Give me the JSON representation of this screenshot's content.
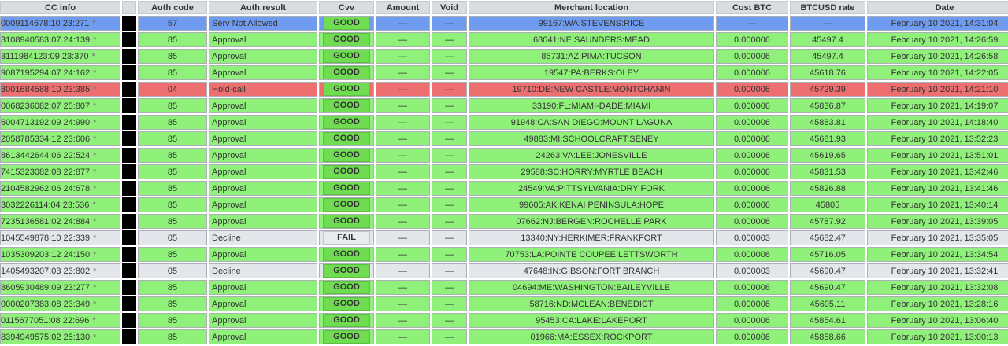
{
  "headers": [
    "CC info",
    "",
    "Auth code",
    "Auth result",
    "Cvv",
    "Amount",
    "Void",
    "Merchant location",
    "Cost BTC",
    "BTCUSD rate",
    "Date"
  ],
  "star": "*",
  "rows": [
    {
      "cc": "0009114678:10 23:271",
      "auth": "57",
      "result": "Serv Not Allowed",
      "cvv": "GOOD",
      "amount": "—",
      "void": "—",
      "location": "99167:WA:STEVENS:RICE",
      "cost": "—",
      "rate": "—",
      "date": "February 10 2021, 14:31:04",
      "status": "selected"
    },
    {
      "cc": "3108940583:07 24:139",
      "auth": "85",
      "result": "Approval",
      "cvv": "GOOD",
      "amount": "—",
      "void": "—",
      "location": "68041:NE:SAUNDERS:MEAD",
      "cost": "0.000006",
      "rate": "45497.4",
      "date": "February 10 2021, 14:26:59",
      "status": "approve"
    },
    {
      "cc": "3111984123:09 23:370",
      "auth": "85",
      "result": "Approval",
      "cvv": "GOOD",
      "amount": "—",
      "void": "—",
      "location": "85731:AZ:PIMA:TUCSON",
      "cost": "0.000006",
      "rate": "45497.4",
      "date": "February 10 2021, 14:26:58",
      "status": "approve"
    },
    {
      "cc": "9087195294:07 24:162",
      "auth": "85",
      "result": "Approval",
      "cvv": "GOOD",
      "amount": "—",
      "void": "—",
      "location": "19547:PA:BERKS:OLEY",
      "cost": "0.000006",
      "rate": "45618.76",
      "date": "February 10 2021, 14:22:05",
      "status": "approve"
    },
    {
      "cc": "8001684588:10 23:385",
      "auth": "04",
      "result": "Hold-call",
      "cvv": "GOOD",
      "amount": "—",
      "void": "—",
      "location": "19710:DE:NEW CASTLE:MONTCHANIN",
      "cost": "0.000006",
      "rate": "45729.39",
      "date": "February 10 2021, 14:21:10",
      "status": "hold"
    },
    {
      "cc": "0068236082:07 25:807",
      "auth": "85",
      "result": "Approval",
      "cvv": "GOOD",
      "amount": "—",
      "void": "—",
      "location": "33190:FL:MIAMI-DADE:MIAMI",
      "cost": "0.000006",
      "rate": "45836.87",
      "date": "February 10 2021, 14:19:07",
      "status": "approve"
    },
    {
      "cc": "6004713192:09 24:990",
      "auth": "85",
      "result": "Approval",
      "cvv": "GOOD",
      "amount": "—",
      "void": "—",
      "location": "91948:CA:SAN DIEGO:MOUNT LAGUNA",
      "cost": "0.000006",
      "rate": "45883.81",
      "date": "February 10 2021, 14:18:40",
      "status": "approve"
    },
    {
      "cc": "2058785334:12 23:606",
      "auth": "85",
      "result": "Approval",
      "cvv": "GOOD",
      "amount": "—",
      "void": "—",
      "location": "49883:MI:SCHOOLCRAFT:SENEY",
      "cost": "0.000006",
      "rate": "45681.93",
      "date": "February 10 2021, 13:52:23",
      "status": "approve"
    },
    {
      "cc": "8613442644:06 22:524",
      "auth": "85",
      "result": "Approval",
      "cvv": "GOOD",
      "amount": "—",
      "void": "—",
      "location": "24263:VA:LEE:JONESVILLE",
      "cost": "0.000006",
      "rate": "45619.65",
      "date": "February 10 2021, 13:51:01",
      "status": "approve"
    },
    {
      "cc": "7415323082:08 22:877",
      "auth": "85",
      "result": "Approval",
      "cvv": "GOOD",
      "amount": "—",
      "void": "—",
      "location": "29588:SC:HORRY:MYRTLE BEACH",
      "cost": "0.000006",
      "rate": "45831.53",
      "date": "February 10 2021, 13:42:46",
      "status": "approve"
    },
    {
      "cc": "2104582962:06 24:678",
      "auth": "85",
      "result": "Approval",
      "cvv": "GOOD",
      "amount": "—",
      "void": "—",
      "location": "24549:VA:PITTSYLVANIA:DRY FORK",
      "cost": "0.000006",
      "rate": "45826.88",
      "date": "February 10 2021, 13:41:46",
      "status": "approve"
    },
    {
      "cc": "3032226114:04 23:536",
      "auth": "85",
      "result": "Approval",
      "cvv": "GOOD",
      "amount": "—",
      "void": "—",
      "location": "99605:AK:KENAI PENINSULA:HOPE",
      "cost": "0.000006",
      "rate": "45805",
      "date": "February 10 2021, 13:40:14",
      "status": "approve"
    },
    {
      "cc": "7235136581:02 24:884",
      "auth": "85",
      "result": "Approval",
      "cvv": "GOOD",
      "amount": "—",
      "void": "—",
      "location": "07662:NJ:BERGEN:ROCHELLE PARK",
      "cost": "0.000006",
      "rate": "45787.92",
      "date": "February 10 2021, 13:39:05",
      "status": "approve"
    },
    {
      "cc": "1045549878:10 22:339",
      "auth": "05",
      "result": "Decline",
      "cvv": "FAIL",
      "amount": "—",
      "void": "—",
      "location": "13340:NY:HERKIMER:FRANKFORT",
      "cost": "0.000003",
      "rate": "45682.47",
      "date": "February 10 2021, 13:35:05",
      "status": "decline"
    },
    {
      "cc": "1035309203:12 24:150",
      "auth": "85",
      "result": "Approval",
      "cvv": "GOOD",
      "amount": "—",
      "void": "—",
      "location": "70753:LA:POINTE COUPEE:LETTSWORTH",
      "cost": "0.000006",
      "rate": "45716.05",
      "date": "February 10 2021, 13:34:54",
      "status": "approve"
    },
    {
      "cc": "1405493207:03 23:802",
      "auth": "05",
      "result": "Decline",
      "cvv": "GOOD",
      "amount": "—",
      "void": "—",
      "location": "47648:IN:GIBSON:FORT BRANCH",
      "cost": "0.000003",
      "rate": "45690.47",
      "date": "February 10 2021, 13:32:41",
      "status": "decline"
    },
    {
      "cc": "8605930489:09 23:277",
      "auth": "85",
      "result": "Approval",
      "cvv": "GOOD",
      "amount": "—",
      "void": "—",
      "location": "04694:ME:WASHINGTON:BAILEYVILLE",
      "cost": "0.000006",
      "rate": "45690.47",
      "date": "February 10 2021, 13:32:08",
      "status": "approve"
    },
    {
      "cc": "0000207383:08 23:349",
      "auth": "85",
      "result": "Approval",
      "cvv": "GOOD",
      "amount": "—",
      "void": "—",
      "location": "58716:ND:MCLEAN:BENEDICT",
      "cost": "0.000006",
      "rate": "45695.11",
      "date": "February 10 2021, 13:28:16",
      "status": "approve"
    },
    {
      "cc": "0115677051:08 22:696",
      "auth": "85",
      "result": "Approval",
      "cvv": "GOOD",
      "amount": "—",
      "void": "—",
      "location": "95453:CA:LAKE:LAKEPORT",
      "cost": "0.000006",
      "rate": "45854.61",
      "date": "February 10 2021, 13:06:40",
      "status": "approve"
    },
    {
      "cc": "8394949575:02 25:130",
      "auth": "85",
      "result": "Approval",
      "cvv": "GOOD",
      "amount": "—",
      "void": "—",
      "location": "01966:MA:ESSEX:ROCKPORT",
      "cost": "0.000006",
      "rate": "45858.66",
      "date": "February 10 2021, 13:00:13",
      "status": "approve"
    }
  ]
}
